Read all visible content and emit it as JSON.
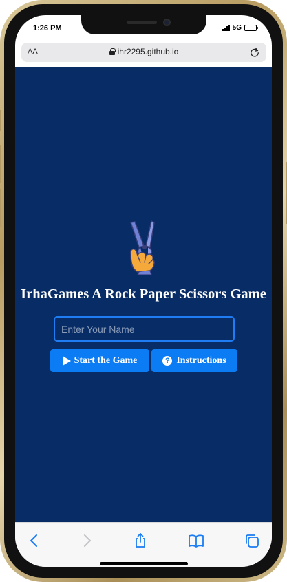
{
  "status_bar": {
    "time": "1:26 PM",
    "network": "5G",
    "battery_level": 0.9
  },
  "browser": {
    "text_size_button": "AA",
    "url": "ihr2295.github.io",
    "lock_icon": "lock-icon",
    "reload_icon": "reload-icon"
  },
  "page": {
    "background_color": "#082c66",
    "logo_icon": "scissors-hand-icon",
    "title": "IrhaGames A Rock Paper Scissors Game",
    "name_input": {
      "placeholder": "Enter Your Name",
      "value": ""
    },
    "start_button": {
      "label": "Start the Game",
      "icon": "play-icon"
    },
    "instructions_button": {
      "label": "Instructions",
      "icon": "question-circle-icon"
    },
    "accent_color": "#0b7cf3"
  },
  "toolbar": {
    "items": [
      {
        "icon": "back-icon",
        "enabled": true
      },
      {
        "icon": "forward-icon",
        "enabled": false
      },
      {
        "icon": "share-icon",
        "enabled": true
      },
      {
        "icon": "bookmarks-icon",
        "enabled": true
      },
      {
        "icon": "tabs-icon",
        "enabled": true
      }
    ],
    "tint_color": "#1a7cf2"
  }
}
